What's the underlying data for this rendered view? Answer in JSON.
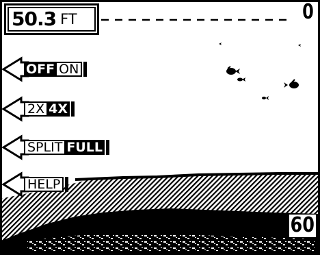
{
  "depth_readout": {
    "value": "50.3",
    "unit": "FT"
  },
  "scale": {
    "top": "0",
    "bottom": "60"
  },
  "menu": [
    {
      "name": "fish-id-toggle",
      "options": [
        {
          "label": "OFF",
          "selected": true
        },
        {
          "label": "ON",
          "selected": false
        }
      ]
    },
    {
      "name": "zoom-toggle",
      "options": [
        {
          "label": "2X",
          "selected": false
        },
        {
          "label": "4X",
          "selected": true
        }
      ]
    },
    {
      "name": "view-toggle",
      "options": [
        {
          "label": "SPLIT",
          "selected": false
        },
        {
          "label": "FULL",
          "selected": true
        }
      ]
    },
    {
      "name": "help",
      "options": [
        {
          "label": "HELP",
          "selected": false
        }
      ]
    }
  ],
  "icons": {
    "fish": "fish-icon",
    "arrow": "left-arrow-icon"
  },
  "colors": {
    "ink": "#000000",
    "paper": "#ffffff"
  }
}
